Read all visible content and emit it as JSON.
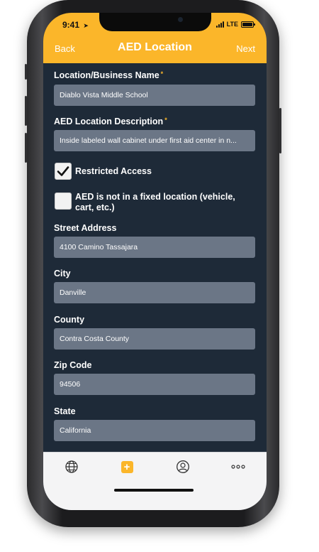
{
  "status_bar": {
    "time": "9:41",
    "network": "LTE"
  },
  "nav": {
    "back_label": "Back",
    "title": "AED Location",
    "next_label": "Next"
  },
  "form": {
    "business_name": {
      "label": "Location/Business Name",
      "required_mark": "*",
      "value": "Diablo Vista Middle School"
    },
    "description": {
      "label": "AED Location Description",
      "required_mark": "*",
      "value": "Inside labeled wall cabinet under first aid center in n..."
    },
    "restricted_access": {
      "label": "Restricted Access",
      "checked": true
    },
    "not_fixed": {
      "label": "AED is not in a fixed location (vehicle, cart, etc.)",
      "checked": false
    },
    "street": {
      "label": "Street Address",
      "value": "4100 Camino Tassajara"
    },
    "city": {
      "label": "City",
      "value": "Danville"
    },
    "county": {
      "label": "County",
      "value": "Contra Costa County"
    },
    "zip": {
      "label": "Zip Code",
      "value": "94506"
    },
    "state": {
      "label": "State",
      "value": "California"
    }
  },
  "tabbar": {
    "tabs": [
      {
        "icon": "globe-icon"
      },
      {
        "icon": "add-icon",
        "glyph": "+"
      },
      {
        "icon": "user-icon"
      },
      {
        "icon": "more-icon"
      }
    ]
  },
  "colors": {
    "accent": "#fbb62a",
    "background": "#1e2a38",
    "input": "#6b7686"
  }
}
